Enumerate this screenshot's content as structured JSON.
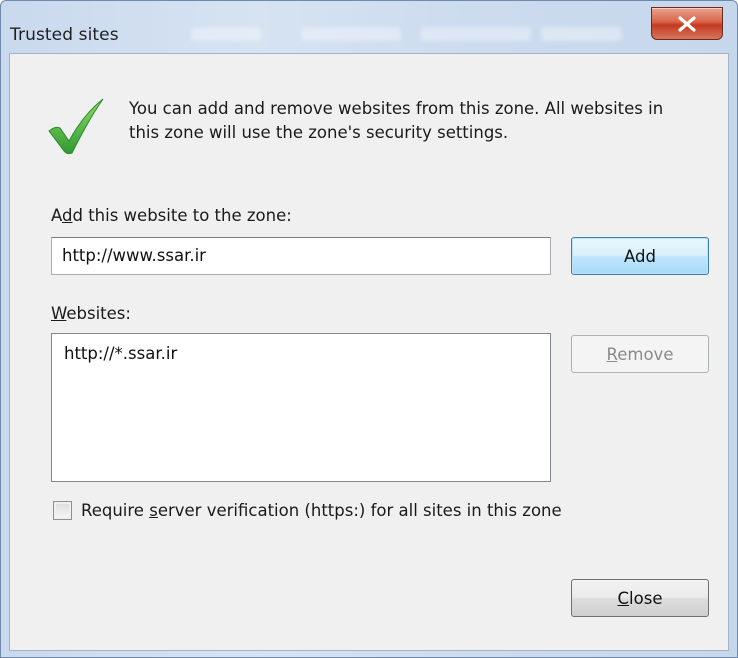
{
  "window": {
    "title": "Trusted sites",
    "close_icon": "close-icon"
  },
  "info": {
    "icon": "checkmark-icon",
    "line1": "You can add and remove websites from this zone. All websites in",
    "line2": "this zone will use the zone's security settings.",
    "accent_color": "#3aa63a"
  },
  "add_section": {
    "label_pre": "A",
    "label_mnemonic": "d",
    "label_post": "d this website to the zone:",
    "input_value": "http://www.ssar.ir",
    "add_button_label": "Add"
  },
  "websites": {
    "label_mnemonic": "W",
    "label_post": "ebsites:",
    "items": [
      "http://*.ssar.ir"
    ],
    "remove_mnemonic": "R",
    "remove_post": "emove"
  },
  "verification": {
    "label_pre": "Require ",
    "label_mnemonic": "s",
    "label_post": "erver verification (https:) for all sites in this zone",
    "checked": false
  },
  "footer": {
    "close_mnemonic": "C",
    "close_post": "lose"
  }
}
